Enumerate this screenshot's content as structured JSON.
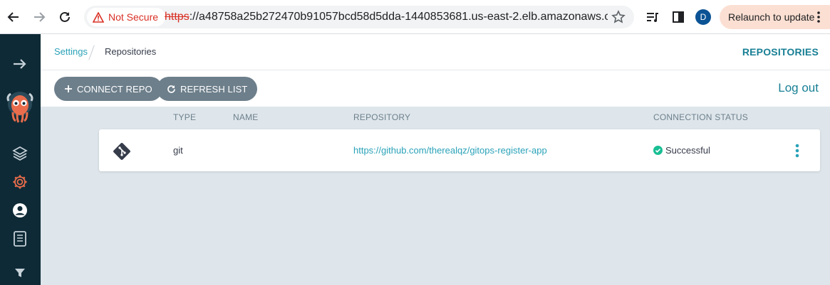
{
  "browser": {
    "security_label": "Not Secure",
    "url_scheme": "https",
    "url_rest": "://a48758a25b272470b91057bcd58d5dda-1440853681.us-east-2.elb.amazonaws.co...",
    "avatar_letter": "D",
    "relaunch_label": "Relaunch to update"
  },
  "sidebar": {
    "items": [
      "arrow-right-icon",
      "argo-logo",
      "layers-icon",
      "settings-gear-icon",
      "user-icon",
      "docs-icon",
      "filter-icon"
    ],
    "active_color": "#e96d4c"
  },
  "breadcrumb": {
    "parent": "Settings",
    "current": "Repositories"
  },
  "page_title": "REPOSITORIES",
  "toolbar": {
    "connect_repo": "CONNECT REPO",
    "refresh_list": "REFRESH LIST",
    "logout": "Log out"
  },
  "table": {
    "headers": {
      "type": "TYPE",
      "name": "NAME",
      "repository": "REPOSITORY",
      "connection_status": "CONNECTION STATUS"
    },
    "rows": [
      {
        "type": "git",
        "name": "",
        "repository": "https://github.com/therealqz/gitops-register-app",
        "connection_status": "Successful"
      }
    ]
  },
  "colors": {
    "accent": "#177f94",
    "link": "#2aa2b8",
    "success": "#18be94",
    "sidebar_bg": "#0e2a36"
  }
}
